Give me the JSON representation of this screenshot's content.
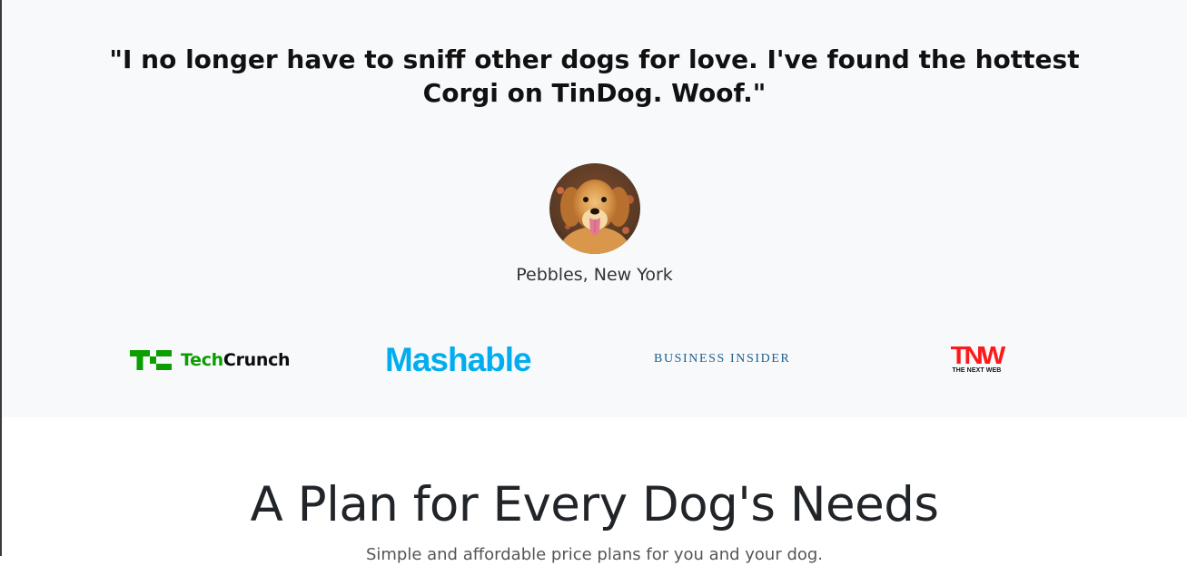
{
  "testimonial": {
    "quote": "\"I no longer have to sniff other dogs for love. I've found the hottest Corgi on TinDog. Woof.\"",
    "author": "Pebbles, New York"
  },
  "press": {
    "techcrunch": {
      "mark": "TC",
      "tech": "Tech",
      "crunch": "Crunch"
    },
    "mashable": "Mashable",
    "business_insider": "BUSINESS INSIDER",
    "tnw": {
      "mark": "TNW",
      "tagline": "THE NEXT WEB"
    }
  },
  "pricing": {
    "title": "A Plan for Every Dog's Needs",
    "subtitle": "Simple and affordable price plans for you and your dog."
  },
  "colors": {
    "section_bg": "#f8f9fb",
    "techcrunch_green": "#0a9e01",
    "mashable_blue": "#00aeef",
    "business_insider_blue": "#1d5f8a",
    "tnw_red": "#ff1a1a"
  }
}
